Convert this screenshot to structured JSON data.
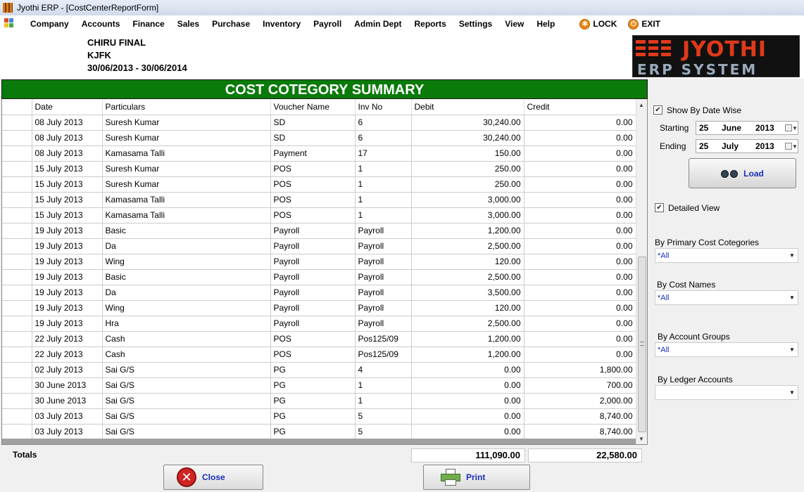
{
  "window": {
    "title": "Jyothi ERP - [CostCenterReportForm]"
  },
  "menu": {
    "items": [
      "Company",
      "Accounts",
      "Finance",
      "Sales",
      "Purchase",
      "Inventory",
      "Payroll",
      "Admin Dept",
      "Reports",
      "Settings",
      "View",
      "Help"
    ],
    "lock": "LOCK",
    "exit": "EXIT"
  },
  "company": {
    "name": "CHIRU FINAL",
    "code": "KJFK",
    "period": "30/06/2013 - 30/06/2014"
  },
  "logo": {
    "main": "JYOTHI",
    "sub": "ERP SYSTEM"
  },
  "report": {
    "title": "COST COTEGORY SUMMARY"
  },
  "grid": {
    "columns": [
      "Date",
      "Particulars",
      "Voucher Name",
      "Inv No",
      "Debit",
      "Credit"
    ],
    "rows": [
      [
        "08 July 2013",
        "Suresh Kumar",
        "SD",
        "6",
        "30,240.00",
        "0.00"
      ],
      [
        "08 July 2013",
        "Suresh Kumar",
        "SD",
        "6",
        "30,240.00",
        "0.00"
      ],
      [
        "08 July 2013",
        "Kamasama Talli",
        "Payment",
        "17",
        "150.00",
        "0.00"
      ],
      [
        "15 July 2013",
        "Suresh Kumar",
        "POS",
        "1",
        "250.00",
        "0.00"
      ],
      [
        "15 July 2013",
        "Suresh Kumar",
        "POS",
        "1",
        "250.00",
        "0.00"
      ],
      [
        "15 July 2013",
        "Kamasama Talli",
        "POS",
        "1",
        "3,000.00",
        "0.00"
      ],
      [
        "15 July 2013",
        "Kamasama Talli",
        "POS",
        "1",
        "3,000.00",
        "0.00"
      ],
      [
        "19 July 2013",
        "Basic",
        "Payroll",
        "Payroll",
        "1,200.00",
        "0.00"
      ],
      [
        "19 July 2013",
        "Da",
        "Payroll",
        "Payroll",
        "2,500.00",
        "0.00"
      ],
      [
        "19 July 2013",
        "Wing",
        "Payroll",
        "Payroll",
        "120.00",
        "0.00"
      ],
      [
        "19 July 2013",
        "Basic",
        "Payroll",
        "Payroll",
        "2,500.00",
        "0.00"
      ],
      [
        "19 July 2013",
        "Da",
        "Payroll",
        "Payroll",
        "3,500.00",
        "0.00"
      ],
      [
        "19 July 2013",
        "Wing",
        "Payroll",
        "Payroll",
        "120.00",
        "0.00"
      ],
      [
        "19 July 2013",
        "Hra",
        "Payroll",
        "Payroll",
        "2,500.00",
        "0.00"
      ],
      [
        "22 July 2013",
        "Cash",
        "POS",
        "Pos125/09",
        "1,200.00",
        "0.00"
      ],
      [
        "22 July 2013",
        "Cash",
        "POS",
        "Pos125/09",
        "1,200.00",
        "0.00"
      ],
      [
        "02 July 2013",
        "Sai G/S",
        "PG",
        "4",
        "0.00",
        "1,800.00"
      ],
      [
        "30 June 2013",
        "Sai G/S",
        "PG",
        "1",
        "0.00",
        "700.00"
      ],
      [
        "30 June 2013",
        "Sai G/S",
        "PG",
        "1",
        "0.00",
        "2,000.00"
      ],
      [
        "03 July 2013",
        "Sai G/S",
        "PG",
        "5",
        "0.00",
        "8,740.00"
      ],
      [
        "03 July 2013",
        "Sai G/S",
        "PG",
        "5",
        "0.00",
        "8,740.00"
      ]
    ]
  },
  "totals": {
    "label": "Totals",
    "debit": "111,090.00",
    "credit": "22,580.00"
  },
  "buttons": {
    "close": "Close",
    "print": "Print",
    "load": "Load"
  },
  "filters": {
    "show_by_date_label": "Show By Date Wise",
    "show_by_date_checked": true,
    "starting_label": "Starting",
    "starting": {
      "day": "25",
      "month": "June",
      "year": "2013"
    },
    "ending_label": "Ending",
    "ending": {
      "day": "25",
      "month": "July",
      "year": "2013"
    },
    "detailed_view_label": "Detailed View",
    "detailed_view_checked": true,
    "primary_cost_label": "By Primary Cost Cotegories",
    "primary_cost_value": "*All",
    "cost_names_label": "By Cost Names",
    "cost_names_value": "*All",
    "account_groups_label": "By Account Groups",
    "account_groups_value": "*All",
    "ledger_label": "By Ledger Accounts",
    "ledger_value": ""
  },
  "colors": {
    "banner": "#0a7a0a",
    "button_text": "#1a2fb8",
    "logo_red": "#e0391b"
  }
}
